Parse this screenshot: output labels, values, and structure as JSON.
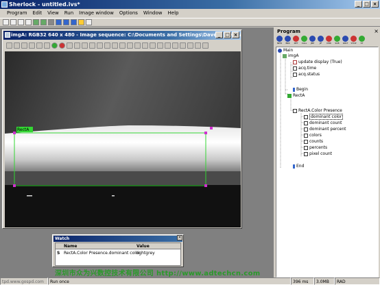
{
  "app": {
    "title": "Sherlock - untitled.ivs*"
  },
  "menubar": [
    "Program",
    "Edit",
    "View",
    "Run",
    "Image window",
    "Options",
    "Window",
    "Help"
  ],
  "image_window": {
    "title": "imgA: RGB32 640 x 480 - Image sequence: C:\\Documents and Settings\\Dave\\My Docum...",
    "roi_label": "RectA"
  },
  "program_panel": {
    "label": "Program",
    "toolbar_labels": [
      "NEW",
      "BRK",
      "RET",
      "CALL",
      "JMP",
      "JIF",
      "CMD",
      "SUB",
      "WAIT",
      "STOP",
      "ST"
    ],
    "tree": [
      {
        "text": "Main",
        "icon": "program-icon"
      },
      {
        "text": "imgA",
        "icon": "image-icon"
      },
      {
        "text": "update display (True)",
        "icon": "boolean-icon"
      },
      {
        "text": "acq.time",
        "icon": "number-icon"
      },
      {
        "text": "acq.status",
        "icon": "number-icon"
      },
      {
        "text": "Begin",
        "icon": "bracket-icon"
      },
      {
        "text": "RectA",
        "icon": "roi-icon"
      },
      {
        "text": "RectA.Color Presence",
        "icon": "algorithm-icon"
      },
      {
        "text": "dominant color",
        "icon": "string-icon"
      },
      {
        "text": "dominant count",
        "icon": "number-icon"
      },
      {
        "text": "dominant percent",
        "icon": "number-icon"
      },
      {
        "text": "colors",
        "icon": "string-array-icon"
      },
      {
        "text": "counts",
        "icon": "number-array-icon"
      },
      {
        "text": "percents",
        "icon": "number-array-icon"
      },
      {
        "text": "pixel count",
        "icon": "number-icon"
      },
      {
        "text": "End",
        "icon": "bracket-icon"
      }
    ]
  },
  "watch": {
    "title": "Watch",
    "columns": [
      "Name",
      "Value"
    ],
    "rows": [
      {
        "type": "S",
        "name": "RectA.Color Presence.dominant color",
        "value": "lightgrey"
      }
    ]
  },
  "status": {
    "left": "Run once",
    "time": "396 ms",
    "memory": "3.0MB",
    "rad": "RAD"
  },
  "watermarks": {
    "footer_text": "深圳市众为兴数控技术有限公司 http://www.adtechcn.com",
    "url_left": "tpd.www.gospd.com"
  }
}
